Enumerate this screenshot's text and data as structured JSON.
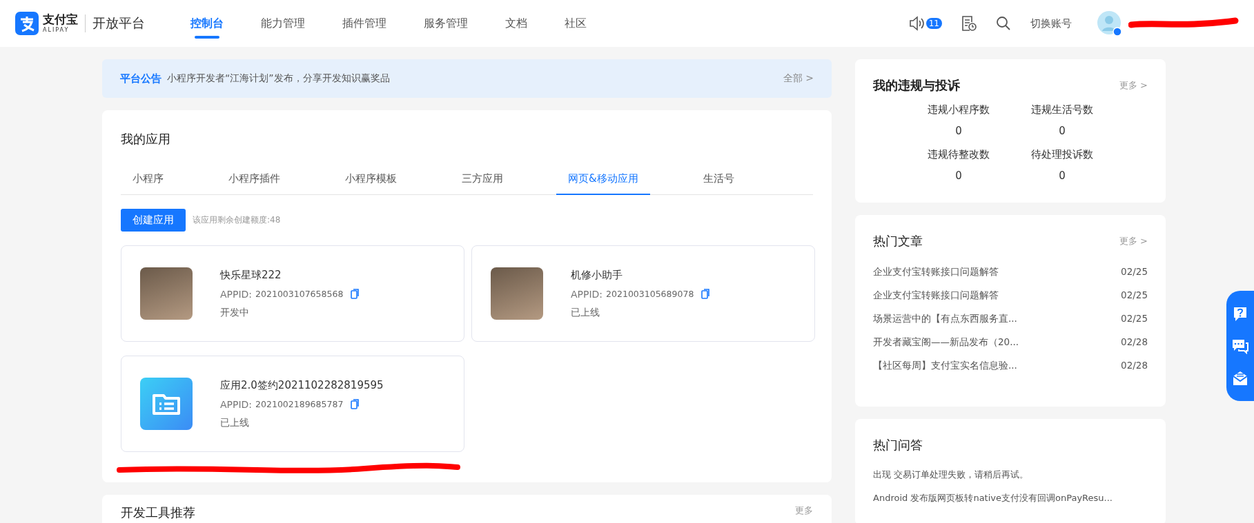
{
  "header": {
    "logo_text": "支付宝",
    "logo_sub": "ALIPAY",
    "platform": "开放平台",
    "nav": [
      {
        "label": "控制台",
        "selected": true
      },
      {
        "label": "能力管理",
        "selected": false
      },
      {
        "label": "插件管理",
        "selected": false
      },
      {
        "label": "服务管理",
        "selected": false
      },
      {
        "label": "文档",
        "selected": false
      },
      {
        "label": "社区",
        "selected": false
      }
    ],
    "notification_count": "11",
    "switch_account": "切换账号"
  },
  "announcement": {
    "label": "平台公告",
    "text": "小程序开发者“江海计划”发布，分享开发知识赢奖品",
    "link": "全部 >"
  },
  "my_apps": {
    "title": "我的应用",
    "tabs": [
      {
        "label": "小程序",
        "selected": false
      },
      {
        "label": "小程序插件",
        "selected": false
      },
      {
        "label": "小程序模板",
        "selected": false
      },
      {
        "label": "三方应用",
        "selected": false
      },
      {
        "label": "网页&移动应用",
        "selected": true
      },
      {
        "label": "生活号",
        "selected": false
      }
    ],
    "create_button": "创建应用",
    "quota": "该应用剩余创建额度:48",
    "apps": [
      {
        "kind": "photo",
        "name": "快乐星球222",
        "appid_label": "APPID:",
        "appid": "2021003107658568",
        "status": "开发中"
      },
      {
        "kind": "photo",
        "name": "机修小助手",
        "appid_label": "APPID:",
        "appid": "2021003105689078",
        "status": "已上线"
      },
      {
        "kind": "folder",
        "name": "应用2.0签约2021102282819595",
        "appid_label": "APPID:",
        "appid": "2021002189685787",
        "status": "已上线"
      }
    ]
  },
  "tools": {
    "title": "开发工具推荐",
    "more": "更多"
  },
  "violations": {
    "title": "我的违规与投诉",
    "more": "更多 >",
    "stats": [
      {
        "label": "违规小程序数",
        "value": "0"
      },
      {
        "label": "违规生活号数",
        "value": "0"
      },
      {
        "label": "违规待整改数",
        "value": "0"
      },
      {
        "label": "待处理投诉数",
        "value": "0"
      }
    ]
  },
  "articles": {
    "title": "热门文章",
    "more": "更多 >",
    "items": [
      {
        "title": "企业支付宝转账接口问题解答",
        "date": "02/25"
      },
      {
        "title": "企业支付宝转账接口问题解答",
        "date": "02/25"
      },
      {
        "title": "场景运营中的【有点东西服务直...",
        "date": "02/25"
      },
      {
        "title": "开发者藏宝阁——新品发布（20...",
        "date": "02/28"
      },
      {
        "title": "【社区每周】支付宝实名信息验...",
        "date": "02/28"
      }
    ]
  },
  "qa": {
    "title": "热门问答",
    "items": [
      "出现 交易订单处理失败，请稍后再试。",
      "Android 发布版网页板转native支付没有回调onPayResu..."
    ]
  }
}
